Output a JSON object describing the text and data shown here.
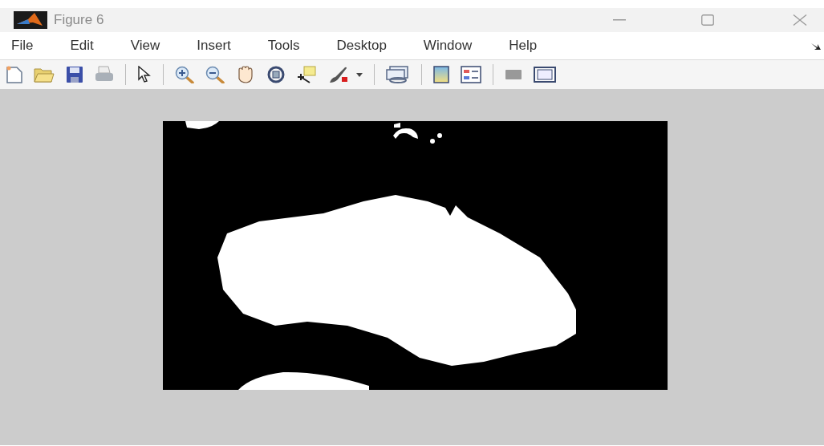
{
  "window": {
    "title": "Figure 6"
  },
  "menu": [
    {
      "label": "File"
    },
    {
      "label": "Edit"
    },
    {
      "label": "View"
    },
    {
      "label": "Insert"
    },
    {
      "label": "Tools"
    },
    {
      "label": "Desktop"
    },
    {
      "label": "Window"
    },
    {
      "label": "Help"
    }
  ]
}
